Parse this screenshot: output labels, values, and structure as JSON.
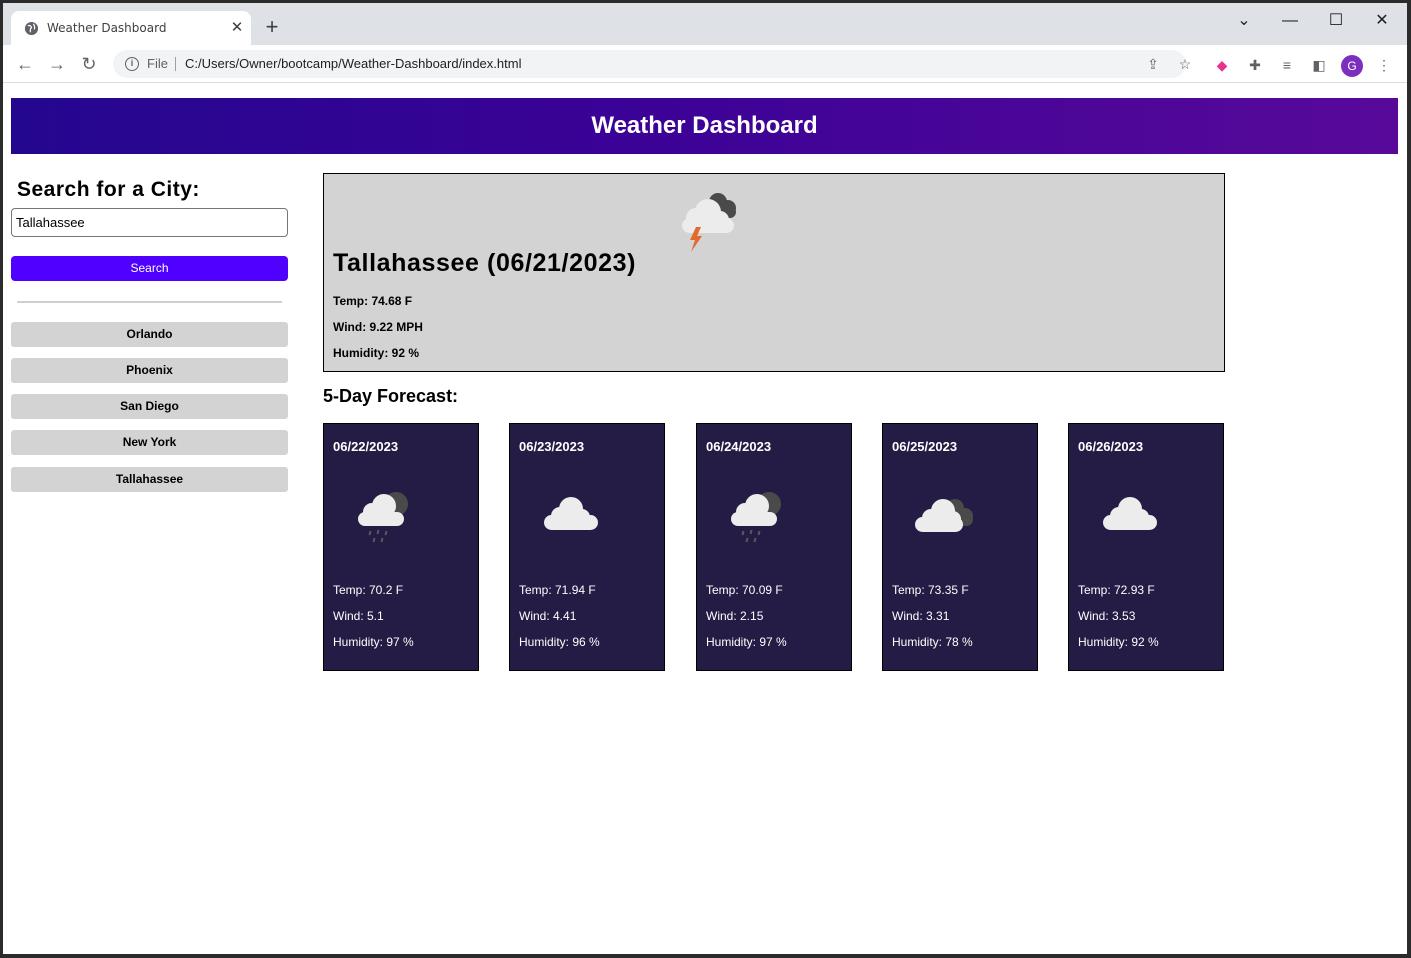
{
  "browser": {
    "tab_title": "Weather Dashboard",
    "file_label": "File",
    "url": "C:/Users/Owner/bootcamp/Weather-Dashboard/index.html",
    "profile_initial": "G"
  },
  "header": {
    "title": "Weather Dashboard"
  },
  "search": {
    "title": "Search for a City:",
    "input_value": "Tallahassee",
    "button_label": "Search"
  },
  "history": [
    "Orlando",
    "Phoenix",
    "San Diego",
    "New York",
    "Tallahassee"
  ],
  "current": {
    "title": "Tallahassee (06/21/2023)",
    "icon": "thunderstorm-icon",
    "temp": "Temp: 74.68 F",
    "wind": "Wind: 9.22 MPH",
    "humidity": "Humidity: 92 %"
  },
  "forecast": {
    "title": "5-Day Forecast:",
    "days": [
      {
        "date": "06/22/2023",
        "icon": "rain-icon",
        "temp": "Temp: 70.2 F",
        "wind": "Wind: 5.1",
        "humidity": "Humidity: 97 %"
      },
      {
        "date": "06/23/2023",
        "icon": "cloud-icon",
        "temp": "Temp: 71.94 F",
        "wind": "Wind: 4.41",
        "humidity": "Humidity: 96 %"
      },
      {
        "date": "06/24/2023",
        "icon": "rain-icon",
        "temp": "Temp: 70.09 F",
        "wind": "Wind: 2.15",
        "humidity": "Humidity: 97 %"
      },
      {
        "date": "06/25/2023",
        "icon": "broken-clouds-icon",
        "temp": "Temp: 73.35 F",
        "wind": "Wind: 3.31",
        "humidity": "Humidity: 78 %"
      },
      {
        "date": "06/26/2023",
        "icon": "cloud-icon",
        "temp": "Temp: 72.93 F",
        "wind": "Wind: 3.53",
        "humidity": "Humidity: 92 %"
      }
    ]
  },
  "colors": {
    "header_gradient_start": "#24078f",
    "header_gradient_end": "#58099a",
    "search_button": "#4f00ff",
    "card_background": "#241c44",
    "current_background": "#d3d3d3"
  }
}
